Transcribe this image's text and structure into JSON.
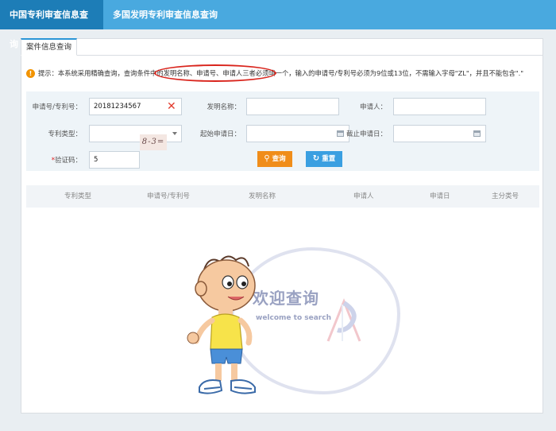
{
  "nav": {
    "tab_domestic": "中国专利审查信息查询",
    "tab_multinational": "多国发明专利审查信息查询"
  },
  "subtab": {
    "label": "案件信息查询"
  },
  "tip": {
    "text": "提示：本系统采用精确查询，查询条件中的发明名称、申请号、申请人三者必须填一个，输入的申请号/专利号必须为9位或13位，不需输入字母\"ZL\"，并且不能包含\".\""
  },
  "form": {
    "app_no_label": "申请号/专利号：",
    "app_no_value": "20181234567",
    "invention_label": "发明名称：",
    "invention_value": "",
    "applicant_label": "申请人：",
    "applicant_value": "",
    "type_label": "专利类型：",
    "type_value": "",
    "start_label": "起始申请日：",
    "start_value": "",
    "end_label": "截止申请日：",
    "end_value": "",
    "captcha_label": "验证码：",
    "captcha_star": "*",
    "captcha_value": "5",
    "captcha_image_text": "8-3="
  },
  "buttons": {
    "query": "查询",
    "reset": "重置"
  },
  "table": {
    "headers": [
      "专利类型",
      "申请号/专利号",
      "发明名称",
      "申请人",
      "申请日",
      "主分类号"
    ]
  },
  "welcome": {
    "cn": "欢迎查询",
    "en": "welcome to search"
  },
  "colors": {
    "nav_bg": "#49a9df",
    "nav_active": "#1d7db7",
    "query_button": "#f08d1a",
    "reset_button": "#3a9fe1",
    "tip_icon": "#f29300",
    "highlight_ellipse": "#d9241c"
  }
}
